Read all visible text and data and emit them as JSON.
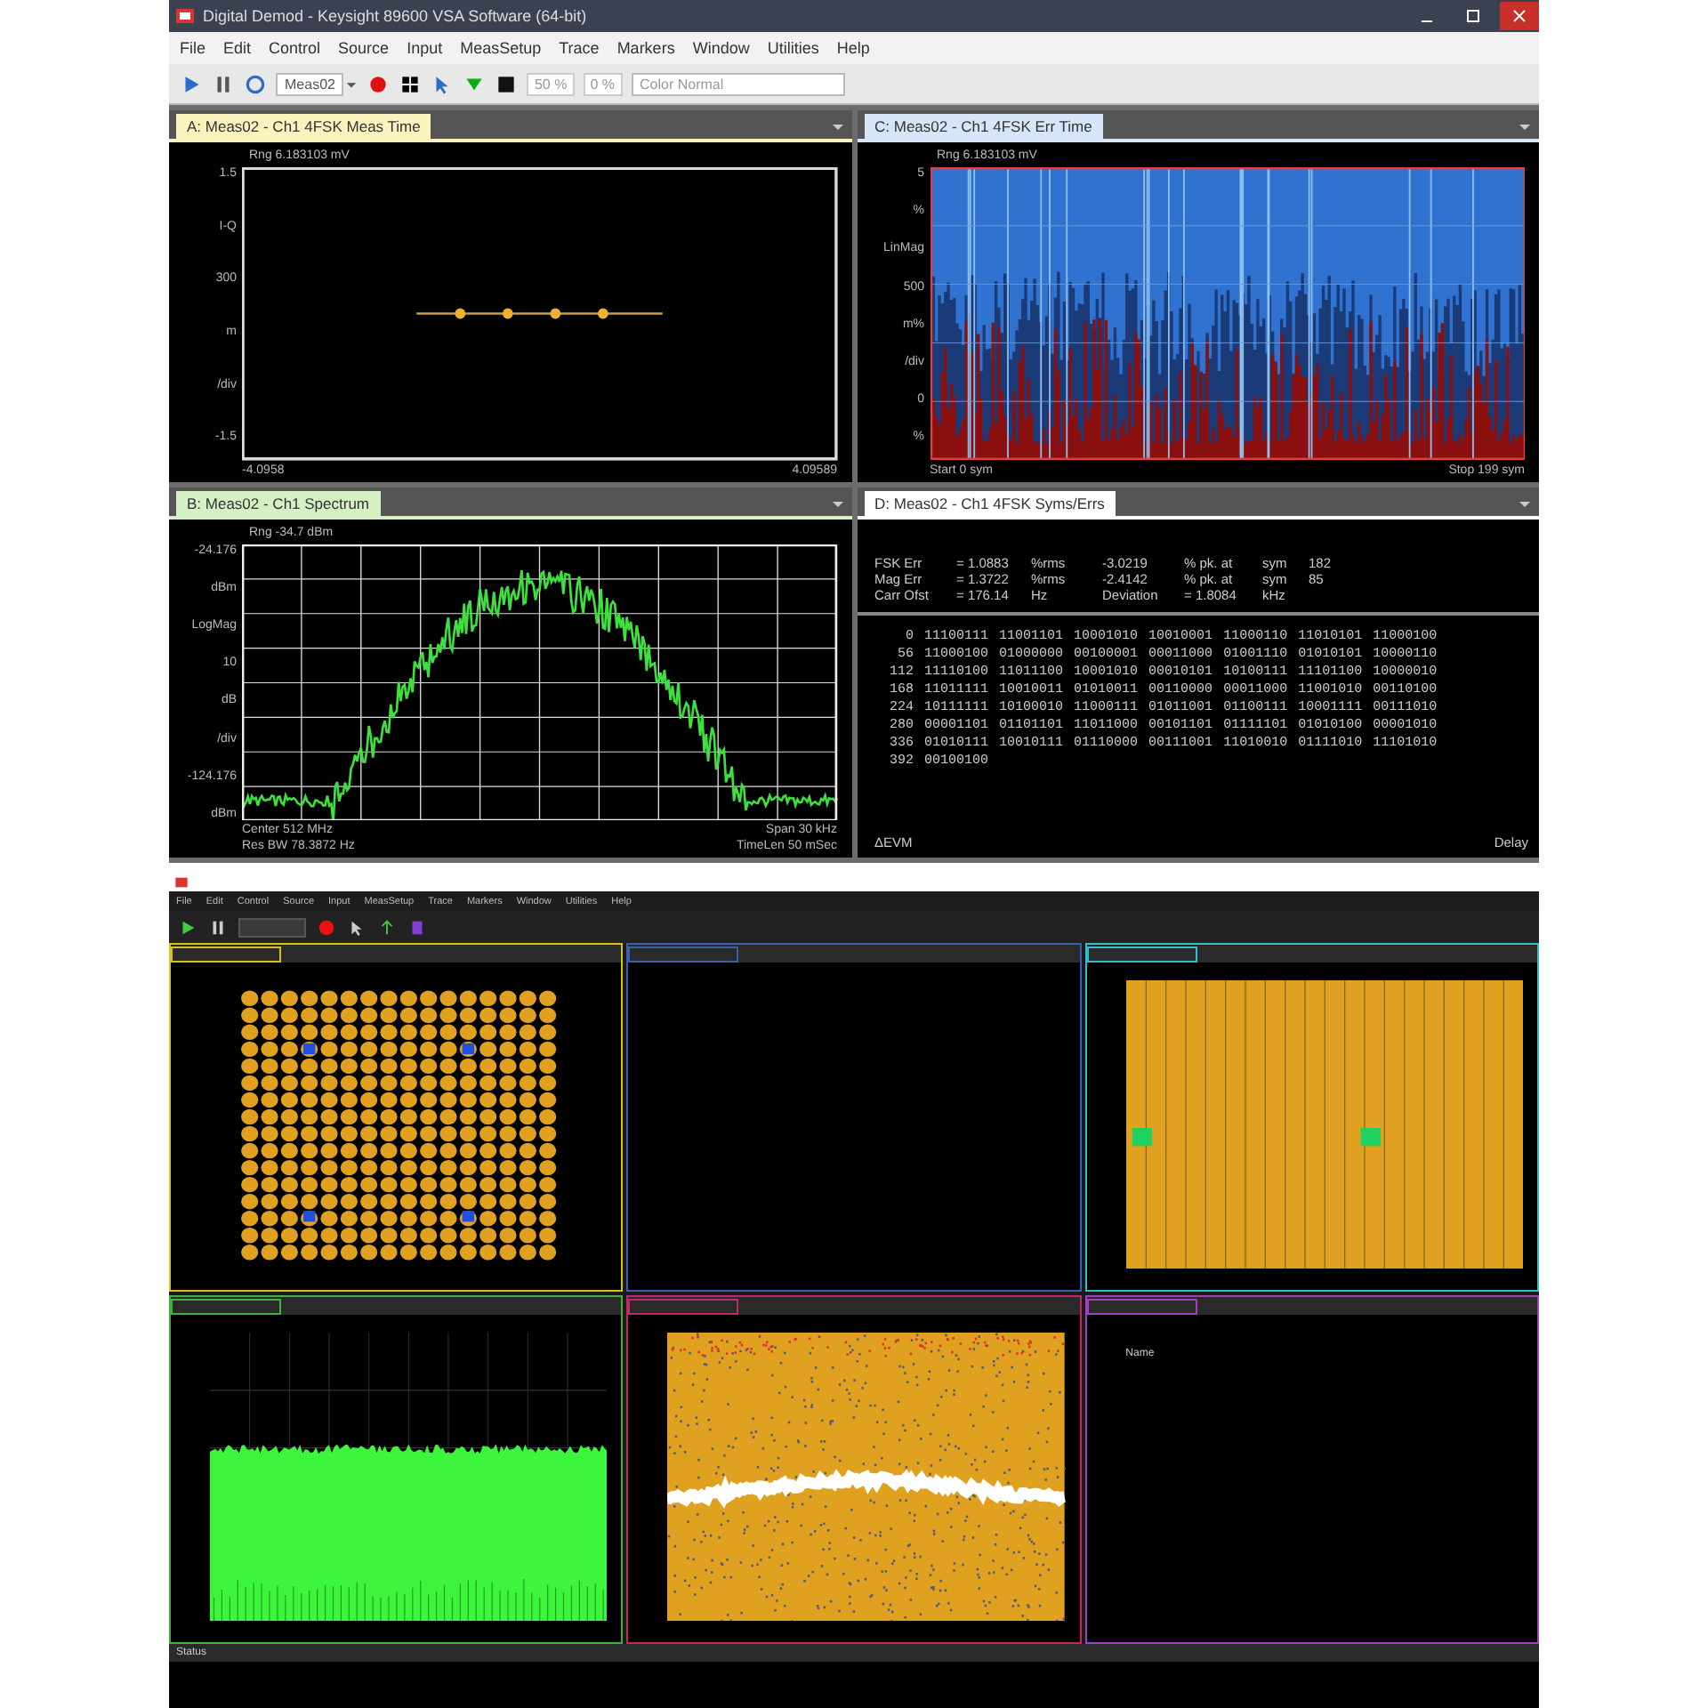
{
  "top_window": {
    "title": "Digital Demod - Keysight 89600 VSA Software (64-bit)",
    "menu": [
      "File",
      "Edit",
      "Control",
      "Source",
      "Input",
      "MeasSetup",
      "Trace",
      "Markers",
      "Window",
      "Utilities",
      "Help"
    ],
    "toolbar": {
      "measurement": "Meas02",
      "percent_a": "50 %",
      "percent_b": "0 %",
      "color_mode": "Color Normal"
    },
    "panes": [
      {
        "kind": "meas_time",
        "title": "A: Meas02 - Ch1 4FSK Meas Time",
        "color": "#fbf3bd",
        "ref": "Rng 6.183103 mV",
        "y_labels": [
          "1.5",
          "I-Q",
          "300",
          "m",
          "/div",
          "-1.5"
        ],
        "footer": [
          [
            "-4.0958",
            "4.09589"
          ]
        ]
      },
      {
        "kind": "err_time",
        "title": "C: Meas02 - Ch1 4FSK Err Time",
        "color": "#d6e6f8",
        "ref": "Rng 6.183103 mV",
        "y_labels": [
          "5",
          "%",
          "LinMag",
          "500",
          "m%",
          "/div",
          "0",
          "%"
        ],
        "footer": [
          [
            "Start 0  sym",
            "Stop 199  sym"
          ]
        ]
      },
      {
        "kind": "spectrum",
        "title": "B: Meas02 - Ch1 Spectrum",
        "color": "#d6f0c6",
        "ref": "Rng -34.7 dBm",
        "y_labels": [
          "-24.176",
          "dBm",
          "LogMag",
          "10",
          "dB",
          "/div",
          "-124.176",
          "dBm"
        ],
        "footer": [
          [
            "Center 512 MHz",
            "Span 30 kHz"
          ],
          [
            "Res BW 78.3872  Hz",
            "TimeLen 50 mSec"
          ]
        ]
      },
      {
        "kind": "syms_errs",
        "title": "D: Meas02 - Ch1 4FSK Syms/Errs",
        "color": "#ffffff",
        "summary": [
          [
            "FSK Err",
            "= 1.0883",
            "%rms",
            "-3.0219",
            "% pk. at",
            "sym",
            "182"
          ],
          [
            "Mag Err",
            "= 1.3722",
            "%rms",
            "-2.4142",
            "% pk. at",
            "sym",
            "85"
          ],
          [
            "Carr Ofst",
            "= 176.14",
            "Hz",
            "Deviation",
            "= 1.8084",
            "kHz"
          ]
        ],
        "rows": [
          {
            "index": "0",
            "bits": [
              "11100111",
              "11001101",
              "10001010",
              "10010001",
              "11000110",
              "11010101",
              "11000100"
            ]
          },
          {
            "index": "56",
            "bits": [
              "11000100",
              "01000000",
              "00100001",
              "00011000",
              "01001110",
              "01010101",
              "10000110"
            ]
          },
          {
            "index": "112",
            "bits": [
              "11110100",
              "11011100",
              "10001010",
              "00010101",
              "10100111",
              "11101100",
              "10000010"
            ]
          },
          {
            "index": "168",
            "bits": [
              "11011111",
              "10010011",
              "01010011",
              "00110000",
              "00011000",
              "11001010",
              "00110100"
            ]
          },
          {
            "index": "224",
            "bits": [
              "10111111",
              "10100010",
              "11000111",
              "01011001",
              "01100111",
              "10001111",
              "00111010"
            ]
          },
          {
            "index": "280",
            "bits": [
              "00001101",
              "01101101",
              "11011000",
              "00101101",
              "01111101",
              "01010100",
              "00001010"
            ]
          },
          {
            "index": "336",
            "bits": [
              "01010111",
              "10010111",
              "01110000",
              "00111001",
              "11010010",
              "01111010",
              "11101010"
            ]
          },
          {
            "index": "392",
            "bits": [
              "00100100"
            ]
          }
        ],
        "footer": [
          [
            "ΔEVM",
            "Delay"
          ]
        ]
      }
    ]
  },
  "bottom_window": {
    "menu": [
      "File",
      "Edit",
      "Control",
      "Source",
      "Input",
      "MeasSetup",
      "Trace",
      "Markers",
      "Window",
      "Utilities",
      "Help"
    ],
    "panes": [
      {
        "kind": "constellation",
        "color": "#d8c020"
      },
      {
        "kind": "summary",
        "color": "#3a5fb0"
      },
      {
        "kind": "stripes",
        "color": "#30c0c8"
      },
      {
        "kind": "spectrum",
        "color": "#40b040"
      },
      {
        "kind": "spectrogram",
        "color": "#c02868"
      },
      {
        "kind": "table",
        "color": "#a040c0",
        "header": "Name"
      }
    ],
    "status": {
      "label": "Status"
    }
  }
}
